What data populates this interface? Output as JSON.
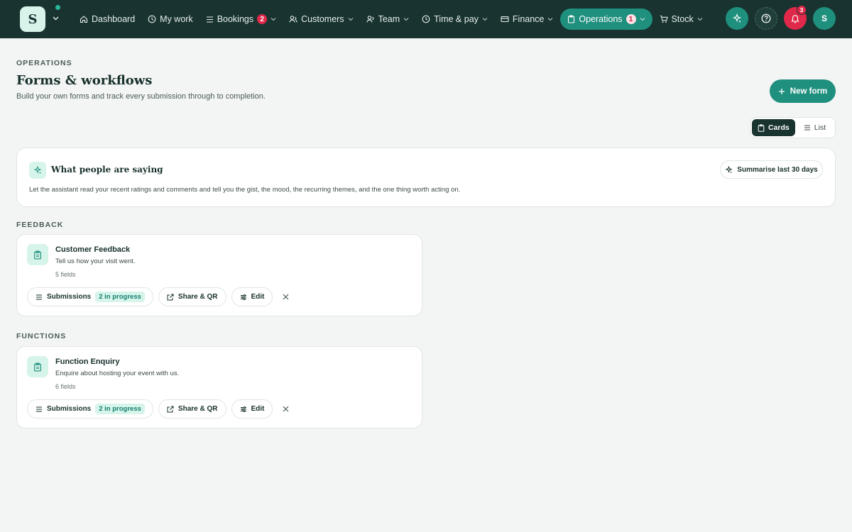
{
  "brand": {
    "logo_letter": "S"
  },
  "nav": [
    {
      "label": "Dashboard",
      "icon": "home-icon"
    },
    {
      "label": "My work",
      "icon": "clock-icon"
    },
    {
      "label": "Bookings",
      "icon": "list-icon",
      "badge": "2"
    },
    {
      "label": "Customers",
      "icon": "customers-icon"
    },
    {
      "label": "Team",
      "icon": "team-icon"
    },
    {
      "label": "Time & pay",
      "icon": "clock-icon"
    },
    {
      "label": "Finance",
      "icon": "card-icon"
    },
    {
      "label": "Operations",
      "icon": "clipboard-icon",
      "badge": "1",
      "active": true
    },
    {
      "label": "Stock",
      "icon": "cart-icon"
    }
  ],
  "top_actions": {
    "notifications_count": "3",
    "avatar_letter": "S"
  },
  "header": {
    "eyebrow": "OPERATIONS",
    "title": "Forms & workflows",
    "subtitle": "Build your own forms and track every submission through to completion.",
    "new_form_label": "New form"
  },
  "view_toggle": {
    "cards_label": "Cards",
    "list_label": "List",
    "selected": "Cards"
  },
  "ai_card": {
    "title": "What people are saying",
    "description": "Let the assistant read your recent ratings and comments and tell you the gist, the mood, the recurring themes, and the one thing worth acting on.",
    "button_label": "Summarise last 30 days"
  },
  "sections": [
    {
      "label": "FEEDBACK",
      "form": {
        "title": "Customer Feedback",
        "description": "Tell us how your visit went.",
        "fields": "5 fields",
        "submissions_label": "Submissions",
        "progress_label": "2 in progress",
        "share_label": "Share & QR",
        "edit_label": "Edit"
      }
    },
    {
      "label": "FUNCTIONS",
      "form": {
        "title": "Function Enquiry",
        "description": "Enquire about hosting your event with us.",
        "fields": "6 fields",
        "submissions_label": "Submissions",
        "progress_label": "2 in progress",
        "share_label": "Share & QR",
        "edit_label": "Edit"
      }
    }
  ],
  "colors": {
    "topbar": "#183330",
    "accent": "#1f8f7e",
    "alert": "#e0294a",
    "mint": "#d6f4ea"
  }
}
